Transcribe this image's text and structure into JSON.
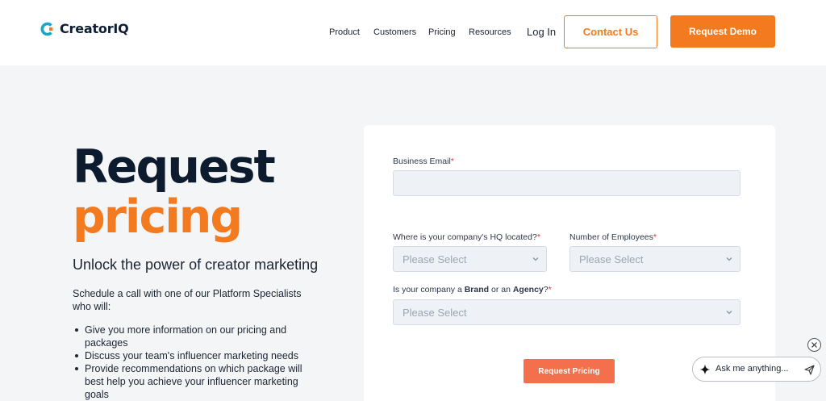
{
  "header": {
    "logo_text": "CreatorIQ",
    "nav": [
      "Product",
      "Customers",
      "Pricing",
      "Resources"
    ],
    "login": "Log In",
    "contact_button": "Contact Us",
    "demo_button": "Request Demo"
  },
  "hero": {
    "title_line1": "Request",
    "title_line2": "pricing",
    "subtitle": "Unlock the power of creator marketing",
    "intro": "Schedule a call with one of our Platform Specialists who will:",
    "bullets": [
      "Give you more information on our pricing and packages",
      "Discuss your team's influencer marketing needs",
      "Provide recommendations on which package will best help you achieve your influencer marketing goals"
    ]
  },
  "form": {
    "email_label": "Business Email",
    "required_mark": "*",
    "email_value": "",
    "hq_label": "Where is your company's HQ located?",
    "hq_placeholder": "Please Select",
    "employees_label": "Number of Employees",
    "employees_placeholder": "Please Select",
    "type_label_prefix": "Is your company a ",
    "type_label_brand": "Brand",
    "type_label_or": " or an ",
    "type_label_agency": "Agency",
    "type_label_suffix": "?",
    "type_placeholder": "Please Select",
    "submit_button": "Request Pricing"
  },
  "chat": {
    "placeholder": "Ask me anything..."
  },
  "colors": {
    "accent": "#f47a20",
    "submit": "#f4704d",
    "dark_text": "#0d1b2e",
    "required": "#e0352b"
  },
  "icons": [
    "creatoriq-logo-icon",
    "chevron-down-icon",
    "sparkle-icon",
    "send-icon",
    "close-icon"
  ]
}
